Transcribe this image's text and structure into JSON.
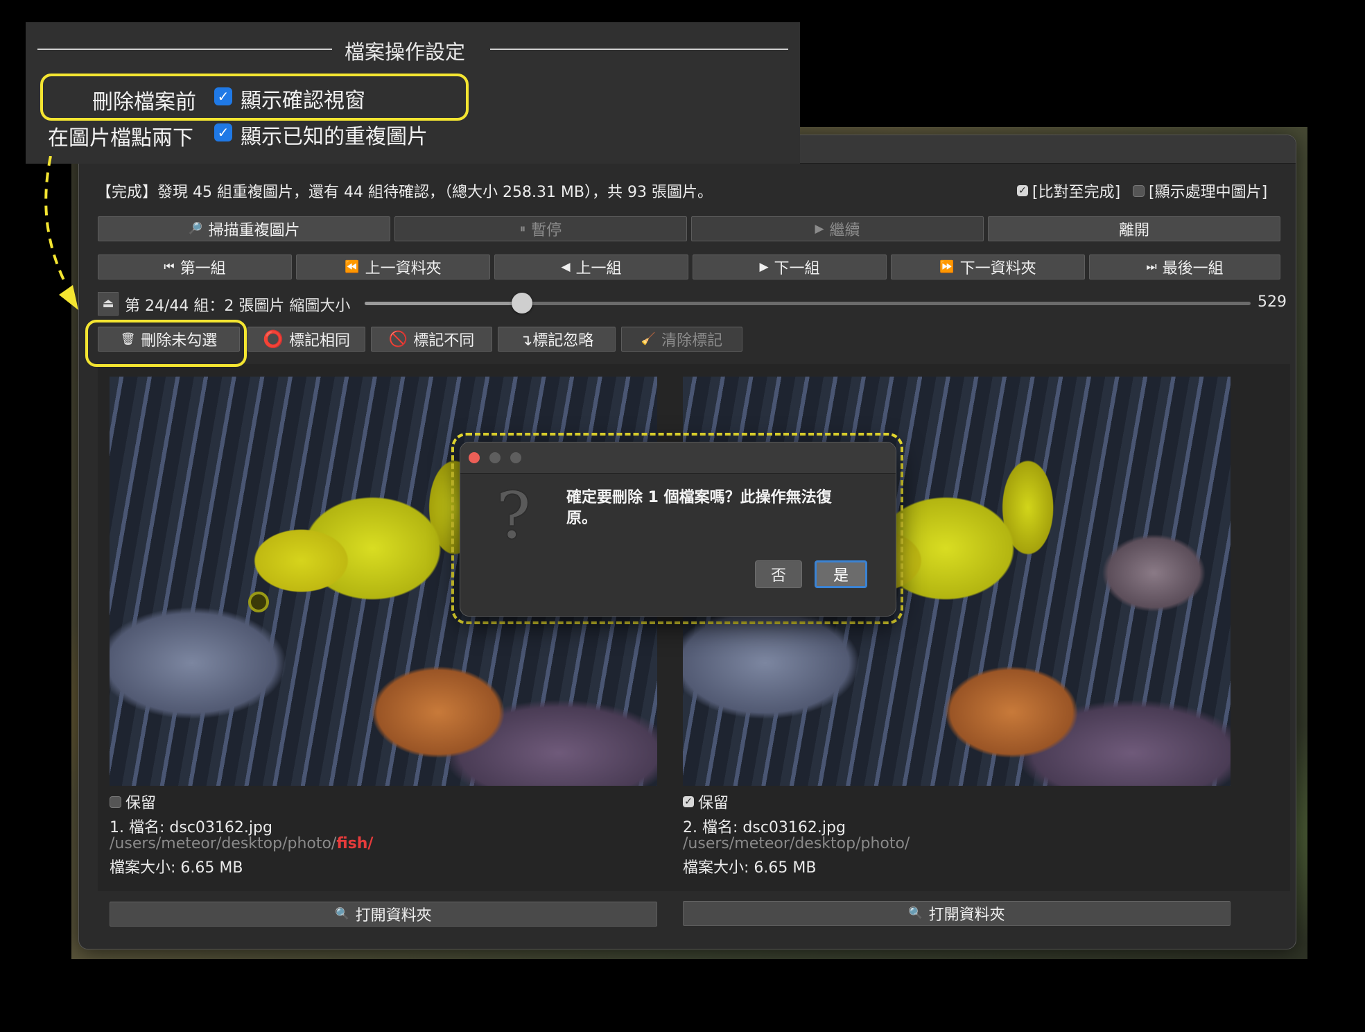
{
  "settings": {
    "title": "檔案操作設定",
    "row1_label": "刪除檔案前",
    "row1_check": "顯示確認視窗",
    "row2_label": "在圖片檔點兩下",
    "row2_check": "顯示已知的重複圖片"
  },
  "status": {
    "text": "【完成】發現 45 組重複圖片，還有 44 組待確認，（總大小 258.31 MB），共 93 張圖片。",
    "compare_done": "[比對至完成]",
    "show_processing": "[顯示處理中圖片]"
  },
  "toolbar1": {
    "scan": "掃描重複圖片",
    "pause": "暫停",
    "resume": "繼續",
    "quit": "離開"
  },
  "toolbar2": {
    "first_group": "第一組",
    "prev_folder": "上一資料夾",
    "prev_group": "上一組",
    "next_group": "下一組",
    "next_folder": "下一資料夾",
    "last_group": "最後一組"
  },
  "slider_row": {
    "label": "第 24/44 組：2 張圖片 縮圖大小",
    "value": "529",
    "position_fraction": 0.178
  },
  "actions": {
    "delete_unchecked": "刪除未勾選",
    "mark_same": "標記相同",
    "mark_different": "標記不同",
    "mark_ignore": "↴標記忽略",
    "clear_marks": "清除標記"
  },
  "images": [
    {
      "keep_label": "保留",
      "keep_checked": false,
      "name": "1. 檔名: dsc03162.jpg",
      "path_prefix": "/users/meteor/desktop/photo/",
      "path_highlight": "fish/",
      "size": "檔案大小: 6.65 MB",
      "open_folder": "打開資料夾"
    },
    {
      "keep_label": "保留",
      "keep_checked": true,
      "name": "2. 檔名: dsc03162.jpg",
      "path_prefix": "/users/meteor/desktop/photo/",
      "path_highlight": "",
      "size": "檔案大小: 6.65 MB",
      "open_folder": "打開資料夾"
    }
  ],
  "dialog": {
    "message": "確定要刪除 1 個檔案嗎？此操作無法復原。",
    "no": "否",
    "yes": "是"
  },
  "colors": {
    "highlight_yellow": "#f4e531",
    "checkbox_blue": "#1f79e6",
    "path_red": "#e53b3b",
    "default_button_ring": "#3b83d3"
  }
}
